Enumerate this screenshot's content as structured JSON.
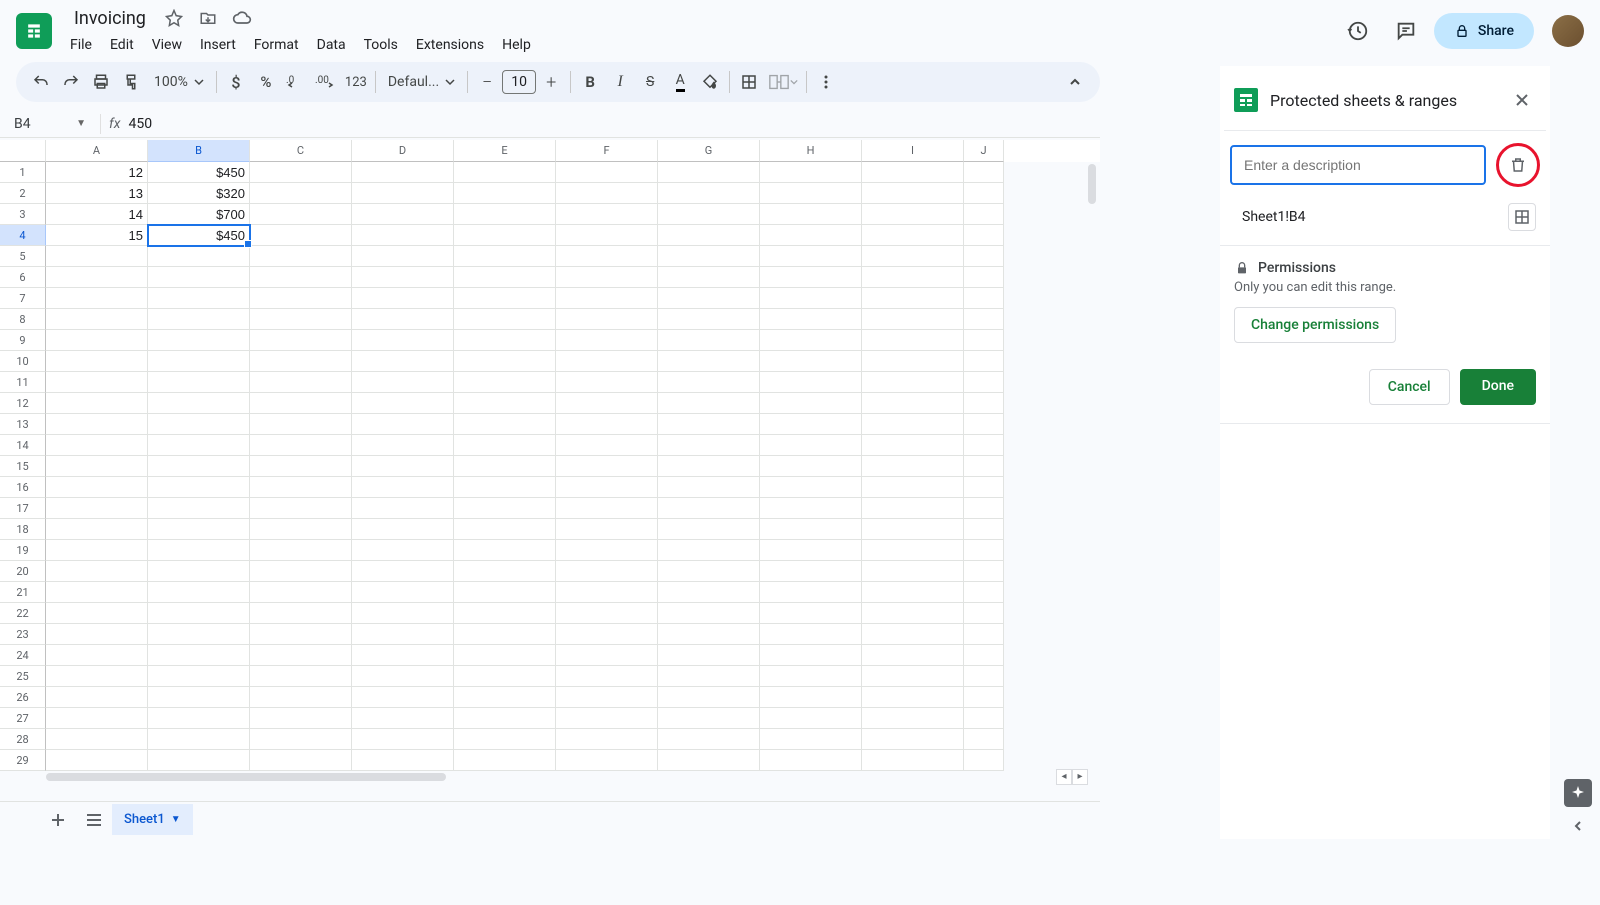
{
  "doc": {
    "title": "Invoicing"
  },
  "menu": {
    "file": "File",
    "edit": "Edit",
    "view": "View",
    "insert": "Insert",
    "format": "Format",
    "data": "Data",
    "tools": "Tools",
    "extensions": "Extensions",
    "help": "Help"
  },
  "share": {
    "label": "Share"
  },
  "toolbar": {
    "zoom": "100%",
    "font": "Defaul...",
    "size": "10",
    "fmt123": "123"
  },
  "namebox": {
    "ref": "B4"
  },
  "fx": {
    "value": "450"
  },
  "cols": [
    "A",
    "B",
    "C",
    "D",
    "E",
    "F",
    "G",
    "H",
    "I",
    "J"
  ],
  "rows": [
    "1",
    "2",
    "3",
    "4",
    "5",
    "6",
    "7",
    "8",
    "9",
    "10",
    "11",
    "12",
    "13",
    "14",
    "15",
    "16",
    "17",
    "18",
    "19",
    "20",
    "21",
    "22",
    "23",
    "24",
    "25",
    "26",
    "27",
    "28",
    "29"
  ],
  "cells": {
    "A1": "12",
    "B1": "$450",
    "A2": "13",
    "B2": "$320",
    "A3": "14",
    "B3": "$700",
    "A4": "15",
    "B4": "$450"
  },
  "active": {
    "row": 4,
    "col": "B"
  },
  "sheet": {
    "tab": "Sheet1"
  },
  "panel": {
    "title": "Protected sheets & ranges",
    "desc_placeholder": "Enter a description",
    "range": "Sheet1!B4",
    "perm_head": "Permissions",
    "perm_sub": "Only you can edit this range.",
    "change": "Change permissions",
    "cancel": "Cancel",
    "done": "Done"
  }
}
